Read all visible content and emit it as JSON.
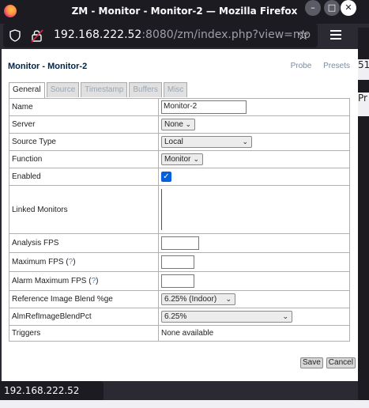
{
  "window": {
    "title": "ZM - Monitor - Monitor-2 — Mozilla Firefox",
    "min": "–",
    "max": "□",
    "close": "✕"
  },
  "urlbar": {
    "host": "192.168.222.52",
    "rest": ":8080/zm/index.php?view=mo",
    "star": "☆"
  },
  "page": {
    "heading": "Monitor - Monitor-2",
    "probe": "Probe",
    "presets": "Presets"
  },
  "tabs": [
    "General",
    "Source",
    "Timestamp",
    "Buffers",
    "Misc"
  ],
  "form": {
    "name_label": "Name",
    "name_value": "Monitor-2",
    "server_label": "Server",
    "server_value": "None",
    "source_type_label": "Source Type",
    "source_type_value": "Local",
    "function_label": "Function",
    "function_value": "Monitor",
    "enabled_label": "Enabled",
    "enabled_checked": true,
    "linked_label": "Linked Monitors",
    "analysis_fps_label": "Analysis FPS",
    "analysis_fps_value": "",
    "max_fps_label": "Maximum FPS",
    "max_fps_value": "",
    "alarm_max_fps_label": "Alarm Maximum FPS",
    "alarm_max_fps_value": "",
    "help_mark": "?",
    "ref_blend_label": "Reference Image Blend %ge",
    "ref_blend_value": "6.25% (Indoor)",
    "alm_blend_label": "AlmRefImageBlendPct",
    "alm_blend_value": "6.25%",
    "triggers_label": "Triggers",
    "triggers_value": "None available"
  },
  "buttons": {
    "save": "Save",
    "cancel": "Cancel"
  },
  "status": {
    "link": "192.168.222.52"
  },
  "right_edge": {
    "c1": "51",
    "c2": "Pr"
  }
}
